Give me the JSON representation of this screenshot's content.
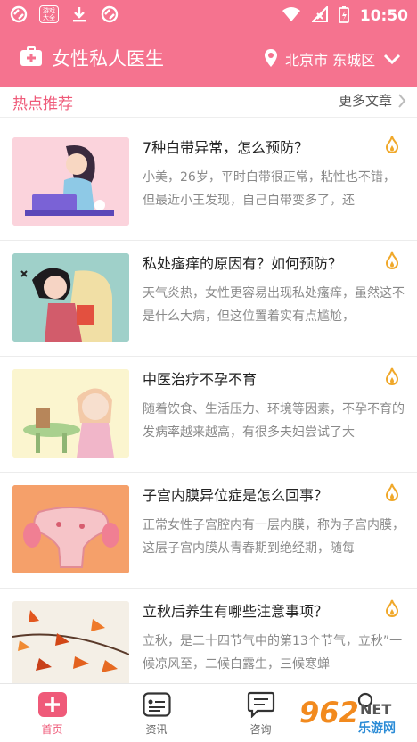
{
  "status_bar": {
    "time": "10:50",
    "icons": [
      "app-icon",
      "game-badge-icon",
      "download-icon",
      "app-icon",
      "wifi-icon",
      "signal-icon",
      "battery-charging-icon"
    ],
    "game_badge_text": "游戏大全"
  },
  "header": {
    "title": "女性私人医生",
    "location": "北京市 东城区",
    "accent": "#f5738f"
  },
  "hot": {
    "title": "热点推荐",
    "more": "更多文章"
  },
  "articles": [
    {
      "title": "7种白带异常，怎么预防？",
      "desc": "小美，26岁，平时白带很正常，粘性也不错，但最近小王发现，自己白带变多了，还"
    },
    {
      "title": "私处瘙痒的原因有？如何预防？",
      "desc": "天气炎热，女性更容易出现私处瘙痒，虽然这不是什么大病，但这位置着实有点尴尬，"
    },
    {
      "title": "中医治疗不孕不育",
      "desc": "随着饮食、生活压力、环境等因素，不孕不育的发病率越来越高，有很多夫妇尝试了大"
    },
    {
      "title": "子宫内膜异位症是怎么回事？",
      "desc": "正常女性子宫腔内有一层内膜，称为子宫内膜，这层子宫内膜从青春期到绝经期，随每"
    },
    {
      "title": "立秋后养生有哪些注意事项？",
      "desc": "立秋，是二十四节气中的第13个节气，立秋”一候凉风至，二候白露生，三候寒蝉"
    }
  ],
  "tabs": [
    {
      "label": "首页",
      "icon": "home-plus-icon",
      "active": true
    },
    {
      "label": "资讯",
      "icon": "news-card-icon",
      "active": false
    },
    {
      "label": "咨询",
      "icon": "chat-icon",
      "active": false
    },
    {
      "label": "",
      "icon": "profile-icon",
      "active": false
    }
  ],
  "watermark": {
    "number": "962",
    "net": "NET",
    "sub": "乐游网"
  }
}
